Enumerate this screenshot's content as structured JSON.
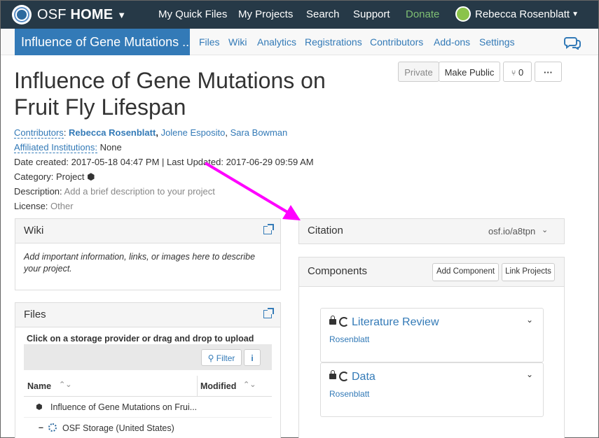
{
  "topnav": {
    "brand_prefix": "OSF",
    "brand_bold": "HOME",
    "links": [
      "My Quick Files",
      "My Projects",
      "Search",
      "Support"
    ],
    "donate": "Donate",
    "user": "Rebecca Rosenblatt"
  },
  "projnav": {
    "title": "Influence of Gene Mutations ...",
    "links": [
      "Files",
      "Wiki",
      "Analytics",
      "Registrations",
      "Contributors",
      "Add-ons",
      "Settings"
    ]
  },
  "header": {
    "title": "Influence of Gene Mutations on Fruit Fly Lifespan",
    "private_label": "Private",
    "make_public_label": "Make Public",
    "fork_count": "0",
    "more_label": "···"
  },
  "meta": {
    "contributors_label": "Contributors",
    "contributors": [
      "Rebecca Rosenblatt",
      "Jolene Esposito",
      "Sara Bowman"
    ],
    "affiliated_label": "Affiliated Institutions:",
    "affiliated_value": "None",
    "dates": "Date created: 2017-05-18 04:47 PM | Last Updated: 2017-06-29 09:59 AM",
    "category_label": "Category:",
    "category_value": "Project",
    "description_label": "Description:",
    "description_value": "Add a brief description to your project",
    "license_label": "License:",
    "license_value": "Other"
  },
  "wiki": {
    "title": "Wiki",
    "placeholder": "Add important information, links, or images here to describe your project."
  },
  "files": {
    "title": "Files",
    "hint": "Click on a storage provider or drag and drop to upload",
    "filter_label": "Filter",
    "col_name": "Name",
    "col_modified": "Modified",
    "rows": [
      "Influence of Gene Mutations on Frui...",
      "OSF Storage (United States)"
    ]
  },
  "citation": {
    "title": "Citation",
    "link": "osf.io/a8tpn"
  },
  "components": {
    "title": "Components",
    "add_label": "Add Component",
    "link_label": "Link Projects",
    "items": [
      {
        "title": "Literature Review",
        "owner": "Rosenblatt"
      },
      {
        "title": "Data",
        "owner": "Rosenblatt"
      }
    ]
  },
  "colors": {
    "navbar": "#263947",
    "accent": "#337ab7",
    "arrow": "#ff00ff"
  }
}
